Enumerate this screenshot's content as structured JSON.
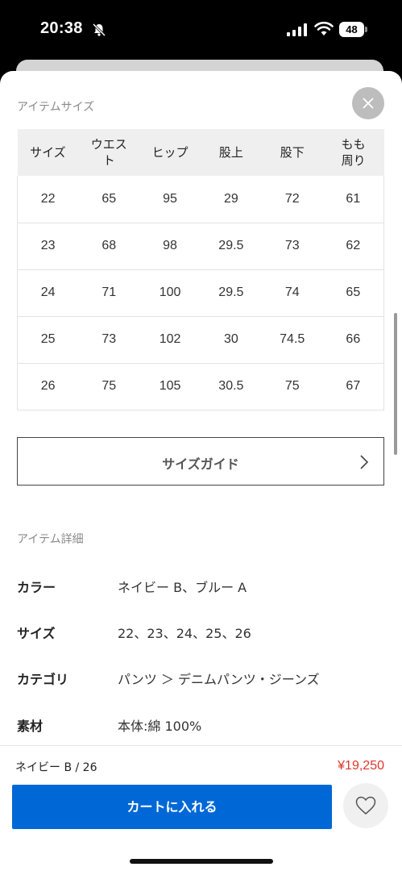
{
  "status_bar": {
    "time": "20:38",
    "battery": "48"
  },
  "size_section": {
    "title": "アイテムサイズ",
    "headers": [
      "サイズ",
      "ウエスト",
      "ヒップ",
      "股上",
      "股下",
      "もも周り"
    ],
    "header_lines": [
      [
        "サイズ"
      ],
      [
        "ウエス",
        "ト"
      ],
      [
        "ヒップ"
      ],
      [
        "股上"
      ],
      [
        "股下"
      ],
      [
        "もも",
        "周り"
      ]
    ],
    "rows": [
      [
        "22",
        "65",
        "95",
        "29",
        "72",
        "61"
      ],
      [
        "23",
        "68",
        "98",
        "29.5",
        "73",
        "62"
      ],
      [
        "24",
        "71",
        "100",
        "29.5",
        "74",
        "65"
      ],
      [
        "25",
        "73",
        "102",
        "30",
        "74.5",
        "66"
      ],
      [
        "26",
        "75",
        "105",
        "30.5",
        "75",
        "67"
      ]
    ],
    "guide_button": "サイズガイド"
  },
  "detail_section": {
    "title": "アイテム詳細",
    "items": [
      {
        "key": "カラー",
        "value": "ネイビー B、ブルー A"
      },
      {
        "key": "サイズ",
        "value": "22、23、24、25、26"
      },
      {
        "key": "カテゴリ",
        "value": "パンツ ＞ デニムパンツ・ジーンズ"
      },
      {
        "key": "素材",
        "value": "本体:綿 100%"
      }
    ]
  },
  "bottom_bar": {
    "selected_variant": "ネイビー B / 26",
    "price": "¥19,250",
    "cart_button": "カートに入れる"
  },
  "colors": {
    "accent": "#0068d6",
    "price": "#e0352b"
  }
}
